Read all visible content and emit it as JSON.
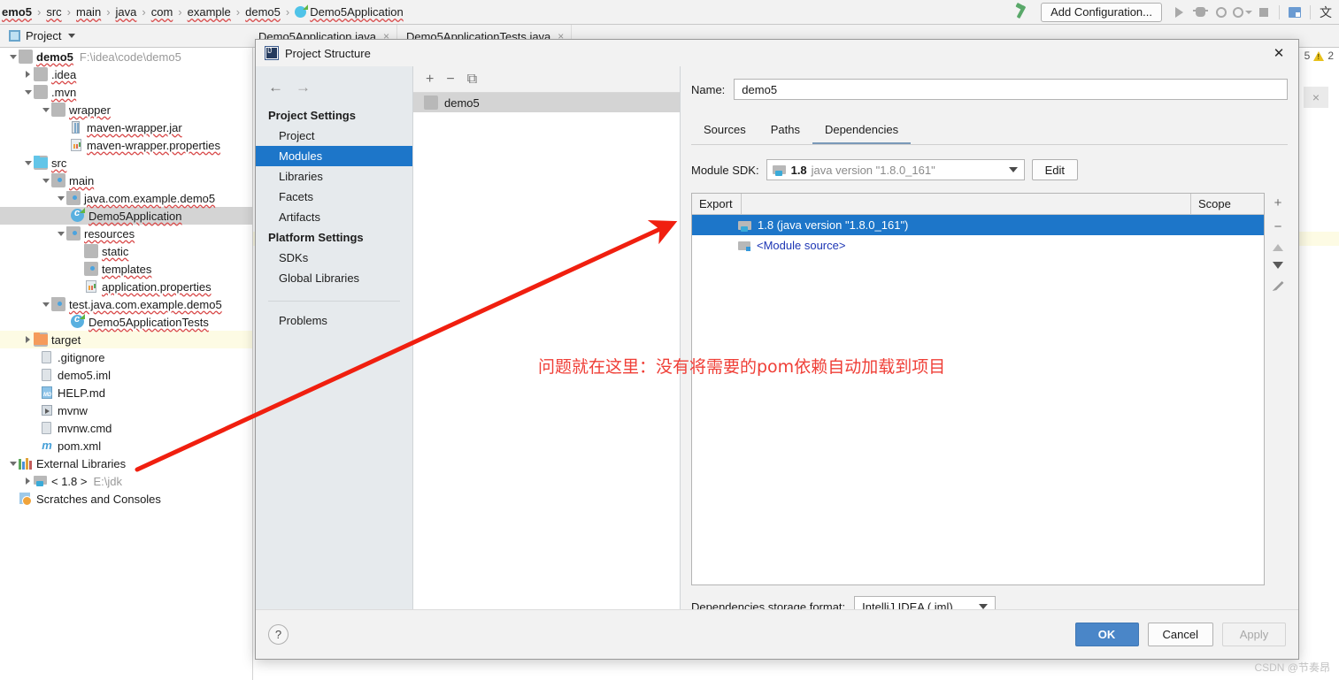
{
  "breadcrumb": {
    "items": [
      {
        "label": "emo5",
        "icon": "",
        "bold": true
      },
      {
        "label": "src",
        "icon": ""
      },
      {
        "label": "main",
        "icon": ""
      },
      {
        "label": "java",
        "icon": ""
      },
      {
        "label": "com",
        "icon": ""
      },
      {
        "label": "example",
        "icon": ""
      },
      {
        "label": "demo5",
        "icon": ""
      },
      {
        "label": "Demo5Application",
        "icon": "java-class-icon"
      }
    ],
    "separator": "›"
  },
  "toolbar": {
    "build_icon": "hammer-icon",
    "add_configuration_label": "Add Configuration...",
    "run_icon": "run-icon",
    "debug_icon": "debug-icon",
    "run_coverage_icon": "run-with-coverage-icon",
    "profile_icon": "profile-icon",
    "stop_icon": "stop-icon",
    "database_icon": "database-icon",
    "translate_icon": "translate-icon"
  },
  "tool_window": {
    "project_label": "Project",
    "project_icon": "project-icon",
    "caret_icon": "chevron-down-icon"
  },
  "editor_tabs": [
    {
      "label": "Demo5Application.java",
      "close_icon": "close-icon"
    },
    {
      "label": "Demo5ApplicationTests.java",
      "close_icon": "close-icon"
    }
  ],
  "gutter": {
    "inspection_count": "5",
    "warning_icon": "warning-triangle-icon",
    "warning_count": "2",
    "close_icon": "close-icon"
  },
  "project_tree": [
    {
      "label": "demo5",
      "path": "F:\\idea\\code\\demo5",
      "icon": "module-folder-icon",
      "arrow": "down",
      "indent": 0,
      "bold": true
    },
    {
      "label": ".idea",
      "icon": "folder-icon",
      "arrow": "right",
      "indent": 1
    },
    {
      "label": ".mvn",
      "icon": "folder-icon",
      "arrow": "down",
      "indent": 1
    },
    {
      "label": "wrapper",
      "icon": "folder-icon",
      "arrow": "down",
      "indent": 2
    },
    {
      "label": "maven-wrapper.jar",
      "icon": "jar-file-icon",
      "arrow": "none",
      "indent": 3
    },
    {
      "label": "maven-wrapper.properties",
      "icon": "properties-file-icon",
      "arrow": "none",
      "indent": 3
    },
    {
      "label": "src",
      "icon": "source-folder-icon",
      "arrow": "down",
      "indent": 1
    },
    {
      "label": "main",
      "icon": "folder-marked-icon",
      "arrow": "down",
      "indent": 2
    },
    {
      "label": "java.com.example.demo5",
      "icon": "folder-marked-icon",
      "arrow": "down",
      "indent": 3
    },
    {
      "label": "Demo5Application",
      "icon": "java-class-icon",
      "arrow": "none",
      "indent": 4,
      "selected": true
    },
    {
      "label": "resources",
      "icon": "folder-marked-icon",
      "arrow": "down",
      "indent": 3
    },
    {
      "label": "static",
      "icon": "folder-icon",
      "arrow": "none",
      "indent": 4
    },
    {
      "label": "templates",
      "icon": "folder-marked-icon",
      "arrow": "none",
      "indent": 4
    },
    {
      "label": "application.properties",
      "icon": "properties-file-icon",
      "arrow": "none",
      "indent": 4
    },
    {
      "label": "test.java.com.example.demo5",
      "icon": "folder-marked-icon",
      "arrow": "down",
      "indent": 2
    },
    {
      "label": "Demo5ApplicationTests",
      "icon": "java-class-icon",
      "arrow": "none",
      "indent": 4
    },
    {
      "label": "target",
      "icon": "excluded-folder-icon",
      "arrow": "right",
      "indent": 1,
      "excluded": true
    },
    {
      "label": ".gitignore",
      "icon": "gitignore-file-icon",
      "arrow": "none",
      "indent": 2
    },
    {
      "label": "demo5.iml",
      "icon": "iml-file-icon",
      "arrow": "none",
      "indent": 2
    },
    {
      "label": "HELP.md",
      "icon": "markdown-file-icon",
      "arrow": "none",
      "indent": 2
    },
    {
      "label": "mvnw",
      "icon": "shell-script-icon",
      "arrow": "none",
      "indent": 2
    },
    {
      "label": "mvnw.cmd",
      "icon": "cmd-file-icon",
      "arrow": "none",
      "indent": 2
    },
    {
      "label": "pom.xml",
      "icon": "maven-pom-icon",
      "arrow": "none",
      "indent": 2
    },
    {
      "label": "External Libraries",
      "icon": "external-libraries-icon",
      "arrow": "down",
      "indent": 0
    },
    {
      "label": "< 1.8 >",
      "path": "E:\\jdk",
      "icon": "jdk-icon",
      "arrow": "right",
      "indent": 1
    },
    {
      "label": "Scratches and Consoles",
      "icon": "scratches-icon",
      "arrow": "none",
      "indent": 0
    }
  ],
  "dialog": {
    "title": "Project Structure",
    "title_icon": "intellij-icon",
    "close_icon": "close-icon",
    "nav": {
      "back_icon": "arrow-left-icon",
      "forward_icon": "arrow-right-icon"
    },
    "sidebar": {
      "project_settings_header": "Project Settings",
      "project_items": [
        "Project",
        "Modules",
        "Libraries",
        "Facets",
        "Artifacts"
      ],
      "selected_item": "Modules",
      "platform_settings_header": "Platform Settings",
      "platform_items": [
        "SDKs",
        "Global Libraries"
      ],
      "problems_item": "Problems"
    },
    "modules_panel": {
      "add_icon": "plus-icon",
      "remove_icon": "minus-icon",
      "copy_icon": "copy-icon",
      "modules": [
        {
          "label": "demo5",
          "icon": "module-icon",
          "selected": true
        }
      ]
    },
    "main": {
      "name_label": "Name:",
      "name_value": "demo5",
      "tabs": [
        "Sources",
        "Paths",
        "Dependencies"
      ],
      "active_tab": "Dependencies",
      "module_sdk_label": "Module SDK:",
      "module_sdk_number": "1.8",
      "module_sdk_version": "java version \"1.8.0_161\"",
      "module_sdk_icon": "jdk-icon",
      "edit_button": "Edit",
      "table": {
        "headers": {
          "export": "Export",
          "scope": "Scope"
        },
        "rows": [
          {
            "label": "1.8 (java version \"1.8.0_161\")",
            "icon": "jdk-icon",
            "selected": true
          },
          {
            "label": "<Module source>",
            "icon": "module-source-icon",
            "selected": false
          }
        ],
        "side_buttons": [
          {
            "icon": "plus-icon",
            "glyph": "+"
          },
          {
            "icon": "minus-icon",
            "glyph": "−"
          },
          {
            "icon": "move-up-icon",
            "glyph": ""
          },
          {
            "icon": "move-down-icon",
            "glyph": ""
          },
          {
            "icon": "edit-pencil-icon",
            "glyph": ""
          }
        ]
      },
      "storage_label": "Dependencies storage format:",
      "storage_value": "IntelliJ IDEA (.iml)"
    },
    "footer": {
      "help_icon": "help-icon",
      "help_glyph": "?",
      "ok_button": "OK",
      "cancel_button": "Cancel",
      "apply_button": "Apply"
    }
  },
  "annotation": {
    "text": "问题就在这里：没有将需要的pom依赖自动加载到项目",
    "color": "#ef3e36",
    "arrow_color": "#f01f0f"
  },
  "watermark": "CSDN @节奏昂"
}
